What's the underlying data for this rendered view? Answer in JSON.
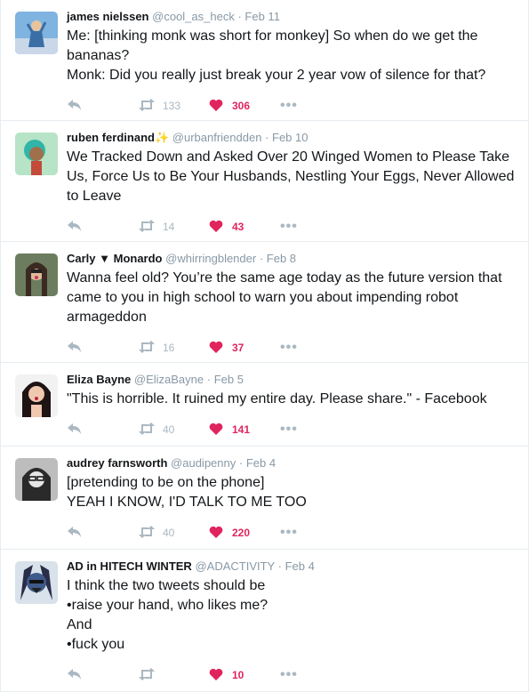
{
  "tweets": [
    {
      "name": "james nielssen",
      "handle": "@cool_as_heck",
      "date": "Feb 11",
      "lines": [
        "Me: [thinking monk was short for monkey] So when do we get the bananas?",
        "Monk: Did you really just break your 2 year vow of silence for that?"
      ],
      "retweets": "133",
      "likes": "306"
    },
    {
      "name": "ruben ferdinand",
      "badge": "✨",
      "handle": "@urbanfriendden",
      "date": "Feb 10",
      "lines": [
        "We Tracked Down and Asked Over 20 Winged Women to Please Take Us, Force Us to Be Your Husbands, Nestling Your Eggs, Never Allowed to Leave"
      ],
      "retweets": "14",
      "likes": "43"
    },
    {
      "name": "Carly ▼ Monardo",
      "handle": "@whirringblender",
      "date": "Feb 8",
      "lines": [
        "Wanna feel old? You’re the same age today as the future version that came to you in high school to warn you about impending robot armageddon"
      ],
      "retweets": "16",
      "likes": "37"
    },
    {
      "name": "Eliza Bayne",
      "handle": "@ElizaBayne",
      "date": "Feb 5",
      "lines": [
        "\"This is horrible. It ruined my entire day. Please share.\" - Facebook"
      ],
      "retweets": "40",
      "likes": "141"
    },
    {
      "name": "audrey farnsworth",
      "handle": "@audipenny",
      "date": "Feb 4",
      "lines": [
        "[pretending to be on the phone]",
        "YEAH I KNOW, I'D TALK TO ME TOO"
      ],
      "retweets": "40",
      "likes": "220"
    },
    {
      "name": "AD in HITECH WINTER",
      "handle": "@ADACTIVITY",
      "date": "Feb 4",
      "lines": [
        "I think the two tweets should be",
        "•raise your hand, who likes me?",
        "And",
        "•fuck you"
      ],
      "retweets": "",
      "likes": "10"
    }
  ],
  "icons": {
    "reply": "reply-icon",
    "retweet": "retweet-icon",
    "like": "heart-icon",
    "more": "more-dots-icon"
  },
  "more_label": "•••",
  "colors": {
    "like": "#e0245e",
    "muted": "#aab8c2",
    "meta": "#8899a6",
    "divider": "#e6ecf0"
  }
}
